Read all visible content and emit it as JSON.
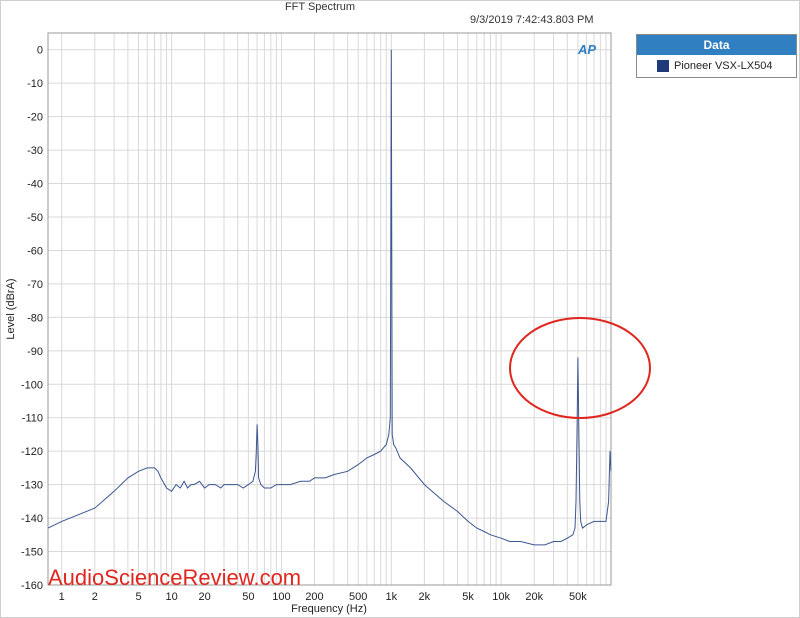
{
  "title": "FFT Spectrum",
  "timestamp": "9/3/2019 7:42:43.803 PM",
  "logo": "AP",
  "watermark": "AudioScienceReview.com",
  "legend": {
    "header": "Data",
    "items": [
      {
        "label": "Pioneer VSX-LX504",
        "color": "#1f3a7a"
      }
    ]
  },
  "colors": {
    "trace": "#3c568f",
    "grid": "#d9d9d9",
    "highlight_circle": "#e0261f",
    "legend_header": "#2f7fc1"
  },
  "chart_data": {
    "type": "line",
    "title": "FFT Spectrum",
    "xlabel": "Frequency (Hz)",
    "ylabel": "Level (dBrA)",
    "x_scale": "log",
    "xlim": [
      0.75,
      100000
    ],
    "ylim": [
      -160,
      5
    ],
    "x_ticks": [
      {
        "v": 1,
        "label": "1"
      },
      {
        "v": 2,
        "label": "2"
      },
      {
        "v": 5,
        "label": "5"
      },
      {
        "v": 10,
        "label": "10"
      },
      {
        "v": 20,
        "label": "20"
      },
      {
        "v": 50,
        "label": "50"
      },
      {
        "v": 100,
        "label": "100"
      },
      {
        "v": 200,
        "label": "200"
      },
      {
        "v": 500,
        "label": "500"
      },
      {
        "v": 1000,
        "label": "1k"
      },
      {
        "v": 2000,
        "label": "2k"
      },
      {
        "v": 5000,
        "label": "5k"
      },
      {
        "v": 10000,
        "label": "10k"
      },
      {
        "v": 20000,
        "label": "20k"
      },
      {
        "v": 50000,
        "label": "50k"
      }
    ],
    "y_ticks": [
      0,
      -10,
      -20,
      -30,
      -40,
      -50,
      -60,
      -70,
      -80,
      -90,
      -100,
      -110,
      -120,
      -130,
      -140,
      -150,
      -160
    ],
    "grid": true,
    "legend_position": "right",
    "series": [
      {
        "name": "Pioneer VSX-LX504",
        "x": [
          0.75,
          1,
          2,
          3,
          4,
          5,
          6,
          7,
          7.5,
          8,
          9,
          10,
          11,
          12,
          13,
          14,
          15,
          16,
          18,
          20,
          22,
          25,
          28,
          30,
          35,
          40,
          45,
          50,
          55,
          58,
          59,
          60,
          61,
          62,
          65,
          70,
          80,
          90,
          100,
          120,
          150,
          180,
          200,
          250,
          300,
          400,
          500,
          600,
          700,
          800,
          900,
          950,
          980,
          1000,
          1020,
          1050,
          1100,
          1200,
          1500,
          2000,
          3000,
          4000,
          5000,
          6000,
          7000,
          8000,
          10000,
          12000,
          15000,
          20000,
          25000,
          30000,
          35000,
          40000,
          45000,
          47000,
          48000,
          49000,
          50000,
          51000,
          52000,
          53000,
          55000,
          60000,
          70000,
          80000,
          90000,
          95000,
          98000,
          100000
        ],
        "y": [
          -143,
          -141,
          -137,
          -132,
          -128,
          -126,
          -125,
          -125,
          -126,
          -128,
          -131,
          -132,
          -130,
          -131,
          -129,
          -131,
          -130,
          -130,
          -129,
          -131,
          -130,
          -130,
          -131,
          -130,
          -130,
          -130,
          -131,
          -130,
          -129,
          -126,
          -120,
          -112,
          -118,
          -128,
          -130,
          -131,
          -131,
          -130,
          -130,
          -130,
          -129,
          -129,
          -128,
          -128,
          -127,
          -126,
          -124,
          -122,
          -121,
          -120,
          -118,
          -115,
          -110,
          0,
          -115,
          -118,
          -119,
          -122,
          -125,
          -130,
          -135,
          -138,
          -141,
          -143,
          -144,
          -145,
          -146,
          -147,
          -147,
          -148,
          -148,
          -147,
          -147,
          -146,
          -145,
          -143,
          -135,
          -115,
          -92,
          -115,
          -135,
          -141,
          -143,
          -142,
          -141,
          -141,
          -141,
          -135,
          -120,
          -126
        ]
      }
    ]
  }
}
